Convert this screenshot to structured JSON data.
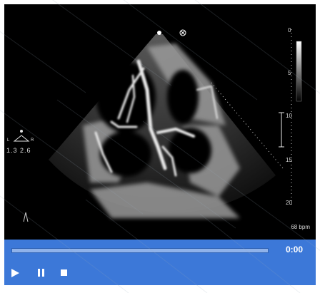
{
  "viewer": {
    "depth_scale": [
      "0",
      "5",
      "10",
      "15",
      "20"
    ],
    "probe_values": "1.3 2.6",
    "heart_rate": "68 bpm",
    "time": "0:00",
    "playback_progress": 0
  },
  "controls": {
    "play_icon": "play-icon",
    "pause_icon": "pause-icon",
    "stop_icon": "stop-icon"
  },
  "colors": {
    "control_bar": "#3c78d8",
    "image_background": "#000000"
  }
}
